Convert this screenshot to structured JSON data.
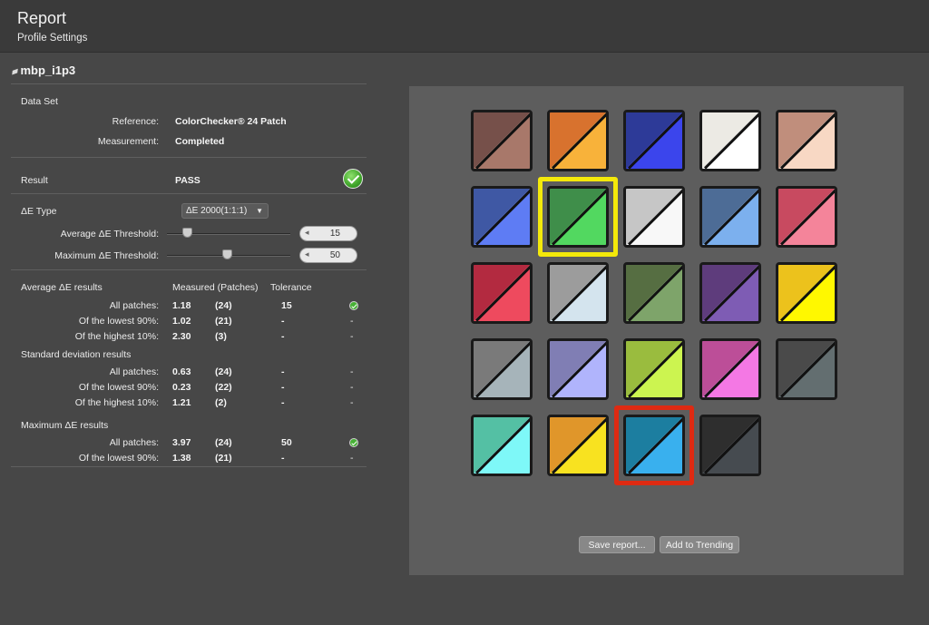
{
  "header": {
    "title": "Report",
    "subtitle": "Profile Settings"
  },
  "profile": {
    "name": "mbp_i1p3",
    "icon": "profile-icon"
  },
  "dataset": {
    "heading": "Data Set",
    "reference_label": "Reference:",
    "reference_value": "ColorChecker® 24 Patch",
    "measurement_label": "Measurement:",
    "measurement_value": "Completed"
  },
  "result": {
    "label": "Result",
    "value": "PASS",
    "status_color": "#3fa52a"
  },
  "de_type": {
    "label": "ΔE Type",
    "selected": "ΔE 2000(1:1:1)"
  },
  "avg_threshold": {
    "label": "Average  ΔE Threshold:",
    "value": "15",
    "slider_fraction": 0.15
  },
  "max_threshold": {
    "label": "Maximum ΔE Threshold:",
    "value": "50",
    "slider_fraction": 0.5
  },
  "results_headers": {
    "measured": "Measured (Patches)",
    "tolerance": "Tolerance"
  },
  "avg_results": {
    "title": "Average ΔE results",
    "rows": [
      {
        "label": "All patches:",
        "value": "1.18",
        "patches": "(24)",
        "tolerance": "15",
        "status": "ok"
      },
      {
        "label": "Of the lowest 90%:",
        "value": "1.02",
        "patches": "(21)",
        "tolerance": "-",
        "status": "-"
      },
      {
        "label": "Of the highest 10%:",
        "value": "2.30",
        "patches": "(3)",
        "tolerance": "-",
        "status": "-"
      }
    ]
  },
  "std_results": {
    "title": "Standard deviation results",
    "rows": [
      {
        "label": "All patches:",
        "value": "0.63",
        "patches": "(24)",
        "tolerance": "-",
        "status": "-"
      },
      {
        "label": "Of the lowest 90%:",
        "value": "0.23",
        "patches": "(22)",
        "tolerance": "-",
        "status": "-"
      },
      {
        "label": "Of the highest 10%:",
        "value": "1.21",
        "patches": "(2)",
        "tolerance": "-",
        "status": "-"
      }
    ]
  },
  "max_results": {
    "title": "Maximum ΔE results",
    "rows": [
      {
        "label": "All patches:",
        "value": "3.97",
        "patches": "(24)",
        "tolerance": "50",
        "status": "ok"
      },
      {
        "label": "Of the lowest 90%:",
        "value": "1.38",
        "patches": "(21)",
        "tolerance": "-",
        "status": "-"
      }
    ]
  },
  "patches": [
    {
      "top": "#76504a",
      "bottom": "#a8786a"
    },
    {
      "top": "#d8722e",
      "bottom": "#f8b23a"
    },
    {
      "top": "#2d3a98",
      "bottom": "#3b45ec"
    },
    {
      "top": "#eceae4",
      "bottom": "#ffffff"
    },
    {
      "top": "#c08e7c",
      "bottom": "#f8d8c4"
    },
    {
      "top": "#3f58a4",
      "bottom": "#5e7cf4"
    },
    {
      "top": "#3f8e4a",
      "bottom": "#52d860",
      "highlight": "yellow"
    },
    {
      "top": "#c6c6c6",
      "bottom": "#f8f8f8"
    },
    {
      "top": "#4d6c96",
      "bottom": "#7cb0ee"
    },
    {
      "top": "#c84a60",
      "bottom": "#f4849a"
    },
    {
      "top": "#b32a40",
      "bottom": "#ee4a5e"
    },
    {
      "top": "#9c9c9c",
      "bottom": "#d4e4ee"
    },
    {
      "top": "#566e42",
      "bottom": "#7ea46a"
    },
    {
      "top": "#5e3c7c",
      "bottom": "#7e5cb4"
    },
    {
      "top": "#ecc21c",
      "bottom": "#fff800"
    },
    {
      "top": "#7a7a7a",
      "bottom": "#a6b4ba"
    },
    {
      "top": "#807eb4",
      "bottom": "#b0b4fc"
    },
    {
      "top": "#9abc3e",
      "bottom": "#ccf450"
    },
    {
      "top": "#bc4e98",
      "bottom": "#f478e4"
    },
    {
      "top": "#4a4a4a",
      "bottom": "#636e70"
    },
    {
      "top": "#54c0a4",
      "bottom": "#7ef8f8"
    },
    {
      "top": "#e0962a",
      "bottom": "#f8e220"
    },
    {
      "top": "#1c7ea0",
      "bottom": "#39b0ee",
      "highlight": "red"
    },
    {
      "top": "#2e2e2e",
      "bottom": "#464b50"
    }
  ],
  "buttons": {
    "save": "Save report...",
    "trend": "Add to Trending"
  }
}
